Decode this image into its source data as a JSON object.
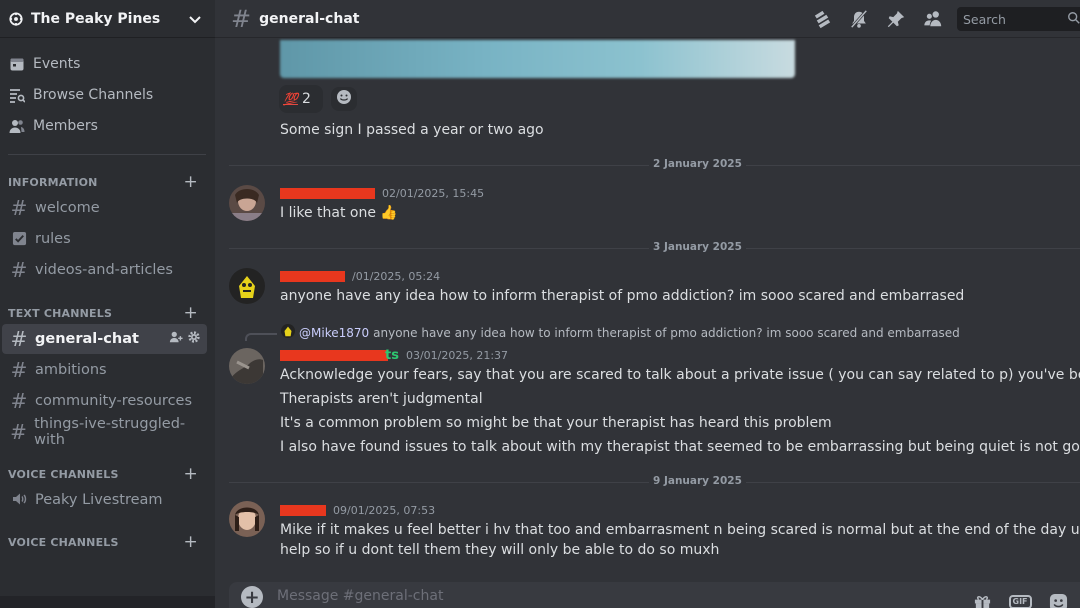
{
  "server": {
    "name": "The Peaky Pines"
  },
  "sidebar": {
    "nav": [
      {
        "label": "Events",
        "icon": "calendar-icon"
      },
      {
        "label": "Browse Channels",
        "icon": "browse-channels-icon"
      },
      {
        "label": "Members",
        "icon": "members-icon"
      }
    ],
    "categories": [
      {
        "label": "INFORMATION"
      },
      {
        "label": "TEXT CHANNELS"
      },
      {
        "label": "VOICE CHANNELS"
      },
      {
        "label": "VOICE CHANNELS"
      }
    ],
    "channels": [
      {
        "label": "welcome",
        "type": "text"
      },
      {
        "label": "rules",
        "type": "rules"
      },
      {
        "label": "videos-and-articles",
        "type": "text"
      },
      {
        "label": "general-chat",
        "type": "text",
        "active": true
      },
      {
        "label": "ambitions",
        "type": "text"
      },
      {
        "label": "community-resources",
        "type": "text"
      },
      {
        "label": "things-ive-struggled-with",
        "type": "text"
      },
      {
        "label": "Peaky Livestream",
        "type": "voice"
      }
    ]
  },
  "header": {
    "channel_name": "general-chat",
    "search_placeholder": "Search",
    "icons": [
      "threads-icon",
      "notifications-muted-icon",
      "pinned-messages-icon",
      "member-list-icon"
    ]
  },
  "reactions": [
    {
      "emoji": "💯",
      "count": "2"
    }
  ],
  "messages": {
    "m0": {
      "text": "Some sign I passed a year or two ago"
    },
    "sep1": "2 January 2025",
    "m1": {
      "timestamp": "02/01/2025, 15:45",
      "text": "I like that one",
      "emoji": "👍"
    },
    "sep2": "3 January 2025",
    "m2": {
      "timestamp": "/01/2025, 05:24",
      "text": "anyone have any idea how to inform therapist of pmo addiction? im sooo scared and embarrased"
    },
    "m3": {
      "reply_mention": "@Mike1870",
      "reply_text": "anyone have any idea how to inform therapist of pmo addiction? im sooo scared and embarrased",
      "username_visible": "ts",
      "timestamp": "03/01/2025, 21:37",
      "lines": [
        "Acknowledge your fears, say that you are scared to talk about a private issue ( you can say related to p) you've been dealing with it",
        "Therapists aren't judgmental",
        "It's a common problem so might be that your therapist has heard this problem",
        "I also have found issues to talk about with my therapist that seemed to be embarrassing but being quiet is not good"
      ]
    },
    "sep3": "9 January 2025",
    "m4": {
      "timestamp": "09/01/2025, 07:53",
      "lines": [
        "Mike if it makes u feel better i hv that too and embarrasment n being scared is normal but at the end of the day ur therapist is there to",
        "help so if u dont tell them they will only be able to do so muxh"
      ]
    }
  },
  "composer": {
    "placeholder": "Message #general-chat",
    "gif_label": "GIF"
  },
  "colors": {
    "accent_red_redaction": "#e8371e",
    "username_green": "#2dc770",
    "mention": "#c9cdfb",
    "bg_main": "#313338",
    "bg_sidebar": "#2b2d31"
  }
}
